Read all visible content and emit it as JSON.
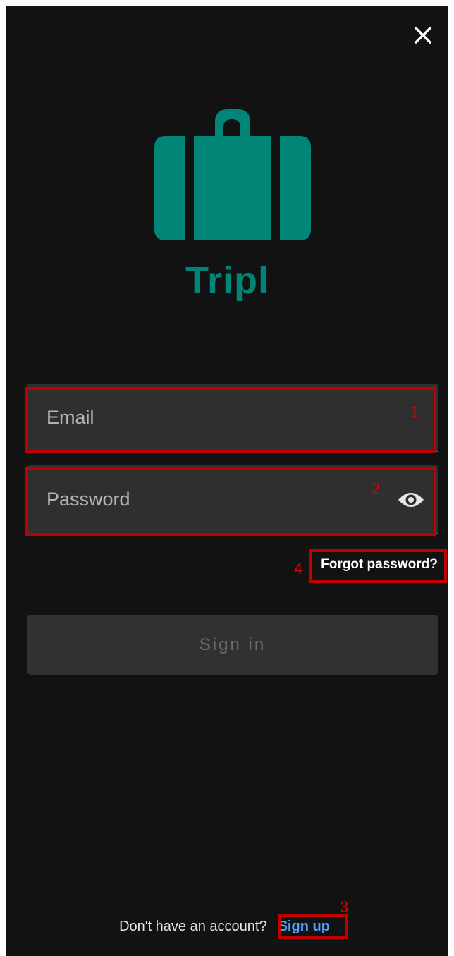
{
  "app": {
    "name": "Tripl",
    "brand_color": "#008577",
    "logo_icon": "suitcase-icon"
  },
  "header": {
    "close_icon": "close-icon"
  },
  "form": {
    "email_placeholder": "Email",
    "email_value": "",
    "password_placeholder": "Password",
    "password_value": "",
    "password_toggle_icon": "eye-icon",
    "forgot_password_label": "Forgot password?",
    "sign_in_label": "Sign in"
  },
  "footer": {
    "question": "Don't have an account?",
    "sign_up_label": "Sign up",
    "link_color": "#4da3ff"
  },
  "annotations": {
    "color": "#c00000",
    "labels": [
      "1",
      "2",
      "3",
      "4"
    ]
  }
}
